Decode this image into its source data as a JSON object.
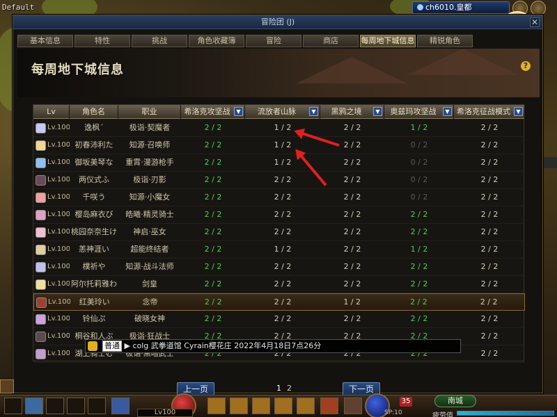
{
  "os": {
    "window_label": "Default"
  },
  "topbar": {
    "server": "ch6010.皇都"
  },
  "window": {
    "title": "冒险团 (J)",
    "close_label": "✕"
  },
  "tabs": [
    {
      "label": "基本信息",
      "active": false
    },
    {
      "label": "特性",
      "active": false
    },
    {
      "label": "挑战",
      "active": false
    },
    {
      "label": "角色收藏簿",
      "active": false
    },
    {
      "label": "冒险",
      "active": false
    },
    {
      "label": "商店",
      "active": false
    },
    {
      "label": "每周地下城信息",
      "active": true
    },
    {
      "label": "精锐角色",
      "active": false
    }
  ],
  "banner": {
    "title": "每周地下城信息",
    "help": "?"
  },
  "table": {
    "headers": [
      {
        "label": "Lv",
        "dropdown": false
      },
      {
        "label": "角色名",
        "dropdown": false
      },
      {
        "label": "职业",
        "dropdown": false
      },
      {
        "label": "希洛克攻坚战",
        "dropdown": true
      },
      {
        "label": "流放者山脉",
        "dropdown": true
      },
      {
        "label": "黑鸦之境",
        "dropdown": true
      },
      {
        "label": "奥兹玛攻坚战",
        "dropdown": true
      },
      {
        "label": "希洛克征战模式",
        "dropdown": true
      }
    ],
    "rows": [
      {
        "lv": "Lv.100",
        "name": "逸枫ˊ",
        "job": "极诣·契魔者",
        "c": [
          "2 / 2",
          "1 / 2",
          "2 / 2",
          "1 / 2",
          "2 / 2"
        ],
        "s": [
          "g",
          "w",
          "w",
          "g",
          "w"
        ],
        "avatar": "#c8c8f0"
      },
      {
        "lv": "Lv.100",
        "name": "初春沛利た",
        "job": "知源·召唤师",
        "c": [
          "2 / 2",
          "1 / 2",
          "2 / 2",
          "0 / 2",
          "2 / 2"
        ],
        "s": [
          "g",
          "w",
          "w",
          "d",
          "w"
        ],
        "avatar": "#f0d890"
      },
      {
        "lv": "Lv.100",
        "name": "御坂美琴な",
        "job": "重霄·漫游枪手",
        "c": [
          "2 / 2",
          "1 / 2",
          "2 / 2",
          "0 / 2",
          "2 / 2"
        ],
        "s": [
          "g",
          "w",
          "w",
          "d",
          "w"
        ],
        "avatar": "#90c0f0"
      },
      {
        "lv": "Lv.100",
        "name": "两仪式ふ",
        "job": "极诣·刃影",
        "c": [
          "2 / 2",
          "2 / 2",
          "2 / 2",
          "0 / 2",
          "2 / 2"
        ],
        "s": [
          "g",
          "w",
          "w",
          "d",
          "w"
        ],
        "avatar": "#6a4a5a"
      },
      {
        "lv": "Lv.100",
        "name": "千咲う",
        "job": "知源·小魔女",
        "c": [
          "2 / 2",
          "2 / 2",
          "2 / 2",
          "0 / 2",
          "2 / 2"
        ],
        "s": [
          "g",
          "w",
          "w",
          "d",
          "w"
        ],
        "avatar": "#f0a0a0"
      },
      {
        "lv": "Lv.100",
        "name": "樱岛麻衣び",
        "job": "皓曦·精灵骑士",
        "c": [
          "2 / 2",
          "2 / 2",
          "2 / 2",
          "2 / 2",
          "2 / 2"
        ],
        "s": [
          "g",
          "w",
          "w",
          "g",
          "w"
        ],
        "avatar": "#e0a0c0"
      },
      {
        "lv": "Lv.100",
        "name": "桃园奈奈生け",
        "job": "神启·巫女",
        "c": [
          "2 / 2",
          "2 / 2",
          "2 / 2",
          "2 / 2",
          "2 / 2"
        ],
        "s": [
          "g",
          "w",
          "w",
          "g",
          "w"
        ],
        "avatar": "#f0c0d0"
      },
      {
        "lv": "Lv.100",
        "name": "恙神涯い",
        "job": "超能终结者",
        "c": [
          "2 / 2",
          "1 / 2",
          "2 / 2",
          "1 / 2",
          "2 / 2"
        ],
        "s": [
          "g",
          "w",
          "w",
          "g",
          "w"
        ],
        "avatar": "#e0d0a0"
      },
      {
        "lv": "Lv.100",
        "name": "樸祈や",
        "job": "知源·战斗法师",
        "c": [
          "2 / 2",
          "2 / 2",
          "2 / 2",
          "2 / 2",
          "2 / 2"
        ],
        "s": [
          "g",
          "w",
          "w",
          "g",
          "w"
        ],
        "avatar": "#c0c0e8"
      },
      {
        "lv": "Lv.100",
        "name": "阿尔托莉雅わ",
        "job": "剑皇",
        "c": [
          "2 / 2",
          "2 / 2",
          "2 / 2",
          "2 / 2",
          "2 / 2"
        ],
        "s": [
          "g",
          "w",
          "w",
          "g",
          "w"
        ],
        "avatar": "#f0e0a0"
      },
      {
        "lv": "Lv.100",
        "name": "红美玲い",
        "job": "念帝",
        "c": [
          "2 / 2",
          "2 / 2",
          "1 / 2",
          "2 / 2",
          "2 / 2"
        ],
        "s": [
          "g",
          "w",
          "w",
          "g",
          "w"
        ],
        "avatar": "#a04030",
        "highlight": true
      },
      {
        "lv": "Lv.100",
        "name": "铃仙ぷ",
        "job": "破晓女神",
        "c": [
          "2 / 2",
          "2 / 2",
          "2 / 2",
          "2 / 2",
          "2 / 2"
        ],
        "s": [
          "g",
          "w",
          "w",
          "g",
          "w"
        ],
        "avatar": "#d0a0e0"
      },
      {
        "lv": "Lv.100",
        "name": "桐谷和人ぶ",
        "job": "极诣·狂战士",
        "c": [
          "2 / 2",
          "2 / 2",
          "2 / 2",
          "2 / 2",
          "2 / 2"
        ],
        "s": [
          "g",
          "w",
          "w",
          "g",
          "w"
        ],
        "avatar": "#5a4a4a"
      },
      {
        "lv": "Lv.100",
        "name": "湖上骑士む",
        "job": "极诣·黑暗武士",
        "c": [
          "2 / 2",
          "2 / 2",
          "2 / 2",
          "2 / 2",
          "2 / 2"
        ],
        "s": [
          "g",
          "w",
          "w",
          "g",
          "w"
        ],
        "avatar": "#c0a0d0"
      }
    ]
  },
  "chat": {
    "channel": "普通",
    "message": "colg 武拳道馆 Cyrain樱花庄 2022年4月18日7点26分"
  },
  "pager": {
    "prev": "上一页",
    "next": "下一页",
    "pages": [
      "1",
      "2"
    ]
  },
  "hud": {
    "level": "Lv100",
    "sp": "SP:10",
    "badge": "35",
    "channel_button": "南城",
    "fatigue_label": "疲劳值"
  },
  "colors": {
    "accent": "#2a4a8a",
    "green": "#4fd14f",
    "annotation": "#e02020"
  }
}
